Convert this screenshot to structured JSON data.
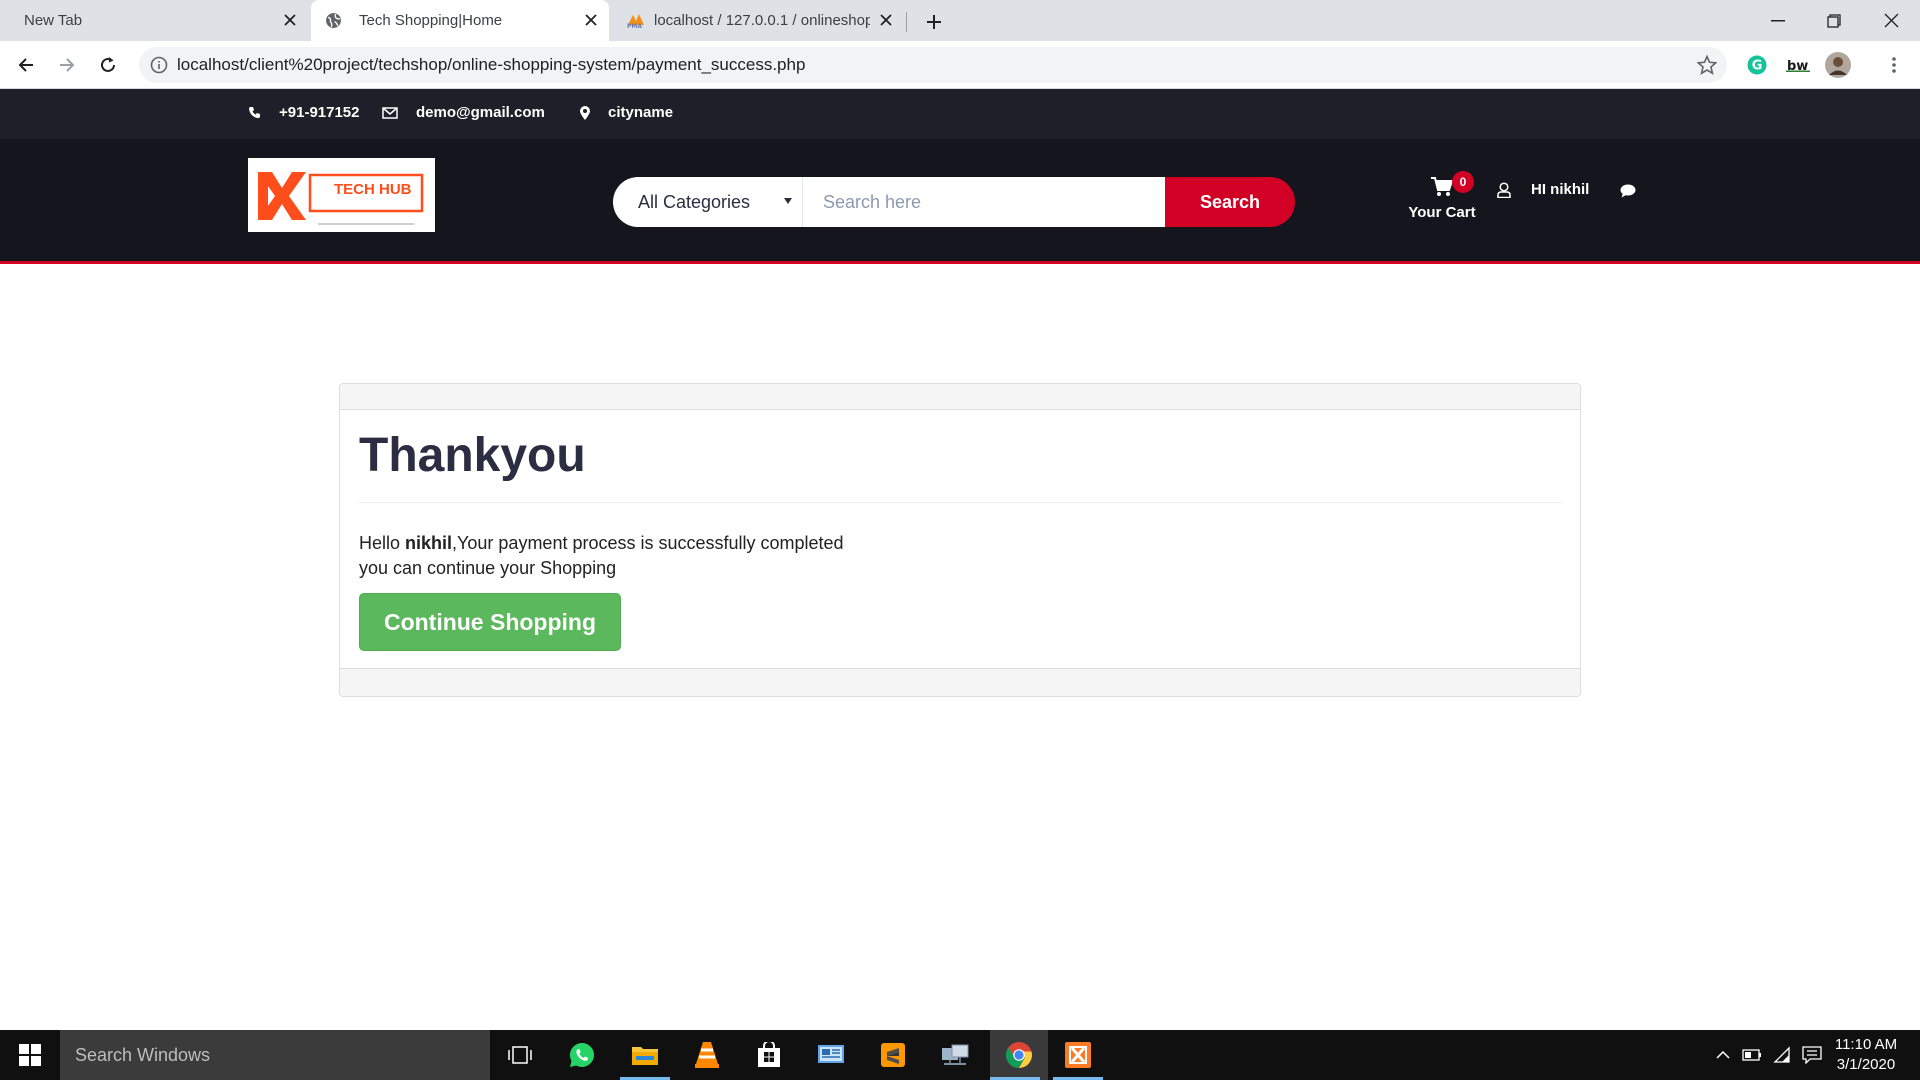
{
  "browser": {
    "tabs": [
      {
        "title": "New Tab",
        "active": false
      },
      {
        "title": "Tech Shopping|Home",
        "active": true
      },
      {
        "title": "localhost / 127.0.0.1 / onlineshop",
        "active": false
      }
    ],
    "url": "localhost/client%20project/techshop/online-shopping-system/payment_success.php",
    "extensions": [
      "grammarly-icon",
      "bw-extension-icon",
      "profile-avatar"
    ],
    "bw_label": "bw"
  },
  "topbar": {
    "phone": "+91-917152",
    "email": "demo@gmail.com",
    "location": "cityname"
  },
  "header": {
    "logo_text": "TECH HUB",
    "category_selected": "All Categories",
    "search_placeholder": "Search here",
    "search_button": "Search",
    "cart_qty": "0",
    "cart_label": "Your Cart",
    "user_greeting": "HI nikhil",
    "colors": {
      "dark": "#15161d",
      "topbar": "#1e1f29",
      "accent": "#d10024"
    }
  },
  "content": {
    "heading": "Thankyou",
    "hello": "Hello ",
    "username": "nikhil",
    "message_rest": ",Your payment process is successfully completed",
    "message_line2": "you can continue your Shopping",
    "continue_button": "Continue Shopping",
    "button_color": "#5cb85c"
  },
  "taskbar": {
    "search_placeholder": "Search Windows",
    "apps": [
      "task-view-icon",
      "whatsapp-icon",
      "file-explorer-icon",
      "vlc-icon",
      "store-icon",
      "control-panel-icon",
      "sublime-text-icon",
      "network-icon",
      "chrome-icon",
      "xampp-icon"
    ],
    "time": "11:10 AM",
    "date": "3/1/2020"
  }
}
